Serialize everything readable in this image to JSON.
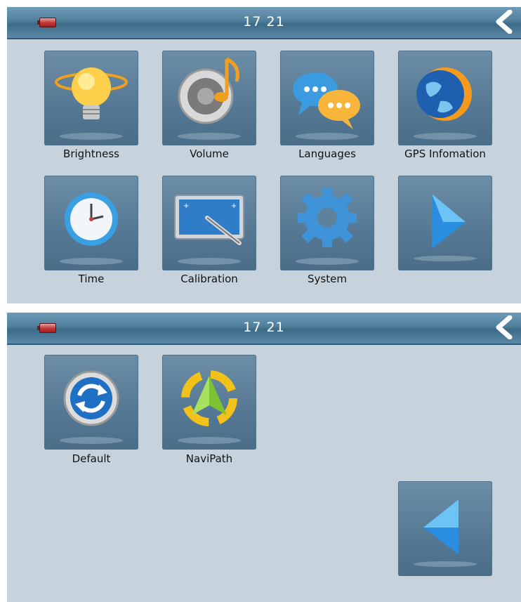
{
  "screen1": {
    "clock": "17 21",
    "tiles": [
      {
        "label": "Brightness",
        "icon": "lightbulb-icon"
      },
      {
        "label": "Volume",
        "icon": "speaker-icon"
      },
      {
        "label": "Languages",
        "icon": "speech-bubbles-icon"
      },
      {
        "label": "GPS Infomation",
        "icon": "globe-icon"
      },
      {
        "label": "Time",
        "icon": "clock-icon"
      },
      {
        "label": "Calibration",
        "icon": "calibration-pen-icon"
      },
      {
        "label": "System",
        "icon": "gear-icon"
      },
      {
        "label": "",
        "icon": "next-page-arrow-icon"
      }
    ]
  },
  "screen2": {
    "clock": "17 21",
    "tiles": [
      {
        "label": "Default",
        "icon": "refresh-icon"
      },
      {
        "label": "NaviPath",
        "icon": "navigation-arrow-icon"
      },
      {
        "label": "",
        "icon": "previous-page-arrow-icon"
      }
    ]
  },
  "colors": {
    "background": "#c6d3dc",
    "topbar": "#4f7f9c",
    "tile": "#5f829c",
    "battery": "#c43b3b"
  }
}
